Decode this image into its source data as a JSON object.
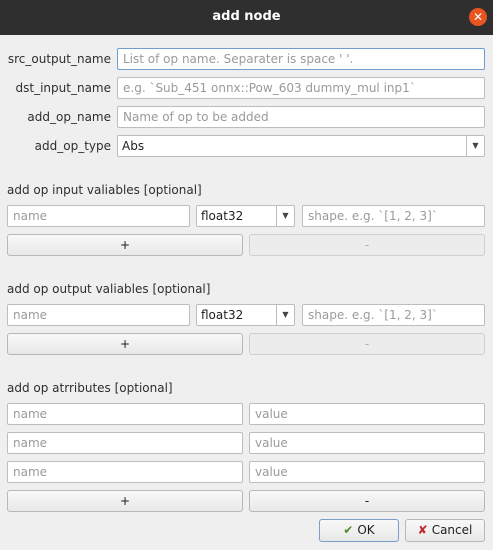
{
  "window": {
    "title": "add node",
    "close_glyph": "✕"
  },
  "form": {
    "src_output_name": {
      "label": "src_output_name",
      "placeholder": "List of op name. Separater is space ' '."
    },
    "dst_input_name": {
      "label": "dst_input_name",
      "placeholder": "e.g. `Sub_451 onnx::Pow_603 dummy_mul inp1`"
    },
    "add_op_name": {
      "label": "add_op_name",
      "placeholder": "Name of op to be added"
    },
    "add_op_type": {
      "label": "add_op_type",
      "value": "Abs"
    }
  },
  "inputs_section": {
    "title": "add op input valiables [optional]",
    "name_placeholder": "name",
    "dtype": "float32",
    "shape_placeholder": "shape. e.g. `[1, 2, 3]`",
    "add_label": "+",
    "remove_label": "-"
  },
  "outputs_section": {
    "title": "add op output valiables [optional]",
    "name_placeholder": "name",
    "dtype": "float32",
    "shape_placeholder": "shape. e.g. `[1, 2, 3]`",
    "add_label": "+",
    "remove_label": "-"
  },
  "attributes_section": {
    "title": "add op atrributes [optional]",
    "rows": [
      {
        "name_placeholder": "name",
        "value_placeholder": "value"
      },
      {
        "name_placeholder": "name",
        "value_placeholder": "value"
      },
      {
        "name_placeholder": "name",
        "value_placeholder": "value"
      }
    ],
    "add_label": "+",
    "remove_label": "-"
  },
  "footer": {
    "ok_label": "OK",
    "cancel_label": "Cancel"
  },
  "icons": {
    "ok": "check-arrow-icon",
    "cancel": "x-mark-icon",
    "combo_arrow": "chevron-down-icon",
    "close": "close-icon"
  },
  "colors": {
    "titlebar": "#2f2f2f",
    "close_button": "#e95420",
    "focus_border": "#6f9fcf",
    "dialog_bg": "#efefef"
  }
}
